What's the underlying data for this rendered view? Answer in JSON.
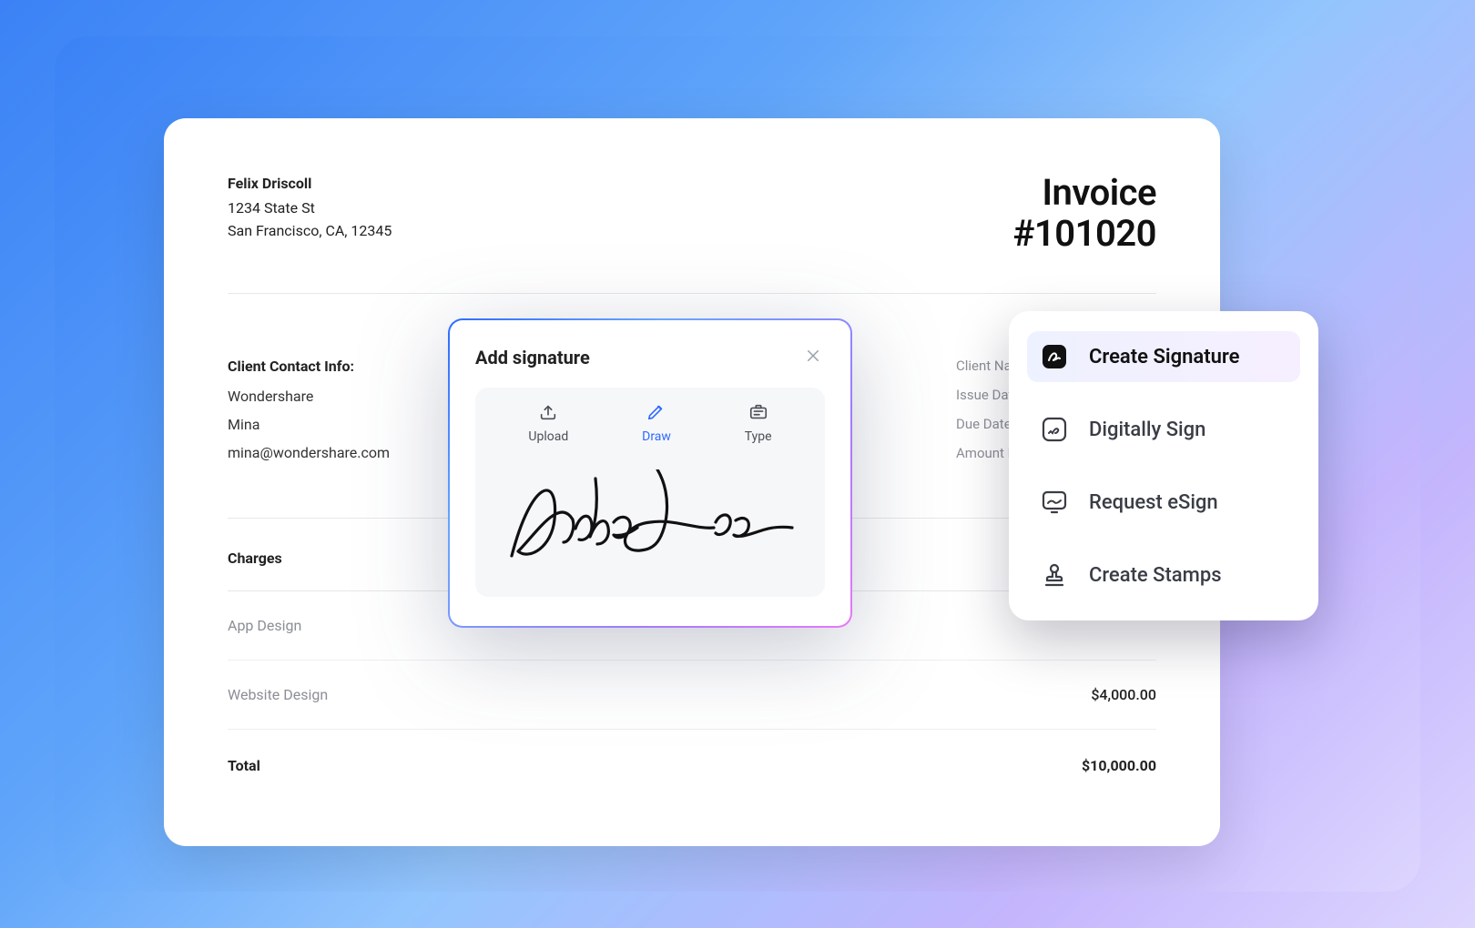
{
  "invoice": {
    "from": {
      "name": "Felix Driscoll",
      "street": "1234 State St",
      "city_line": "San Francisco, CA, 12345"
    },
    "title_line1": "Invoice",
    "title_line2": "#101020",
    "contact_heading": "Client Contact Info:",
    "contact": {
      "company": "Wondershare",
      "person": "Mina",
      "email": "mina@wondershare.com"
    },
    "meta_labels": {
      "client_name": "Client Name",
      "issue_date": "Issue Date",
      "due_date": "Due Date",
      "amount_due": "Amount Due"
    },
    "charges_heading": "Charges",
    "line_items": [
      {
        "label": "App Design",
        "amount": ""
      },
      {
        "label": "Website Design",
        "amount": "$4,000.00"
      }
    ],
    "total_label": "Total",
    "total_amount": "$10,000.00"
  },
  "modal": {
    "title": "Add signature",
    "tabs": {
      "upload": "Upload",
      "draw": "Draw",
      "type": "Type"
    },
    "active_tab": "draw",
    "signature_name": "John Doe"
  },
  "menu": {
    "items": [
      {
        "id": "create-signature",
        "label": "Create Signature",
        "active": true
      },
      {
        "id": "digitally-sign",
        "label": "Digitally Sign",
        "active": false
      },
      {
        "id": "request-esign",
        "label": "Request eSign",
        "active": false
      },
      {
        "id": "create-stamps",
        "label": "Create Stamps",
        "active": false
      }
    ]
  },
  "colors": {
    "accent": "#2f6bff"
  }
}
